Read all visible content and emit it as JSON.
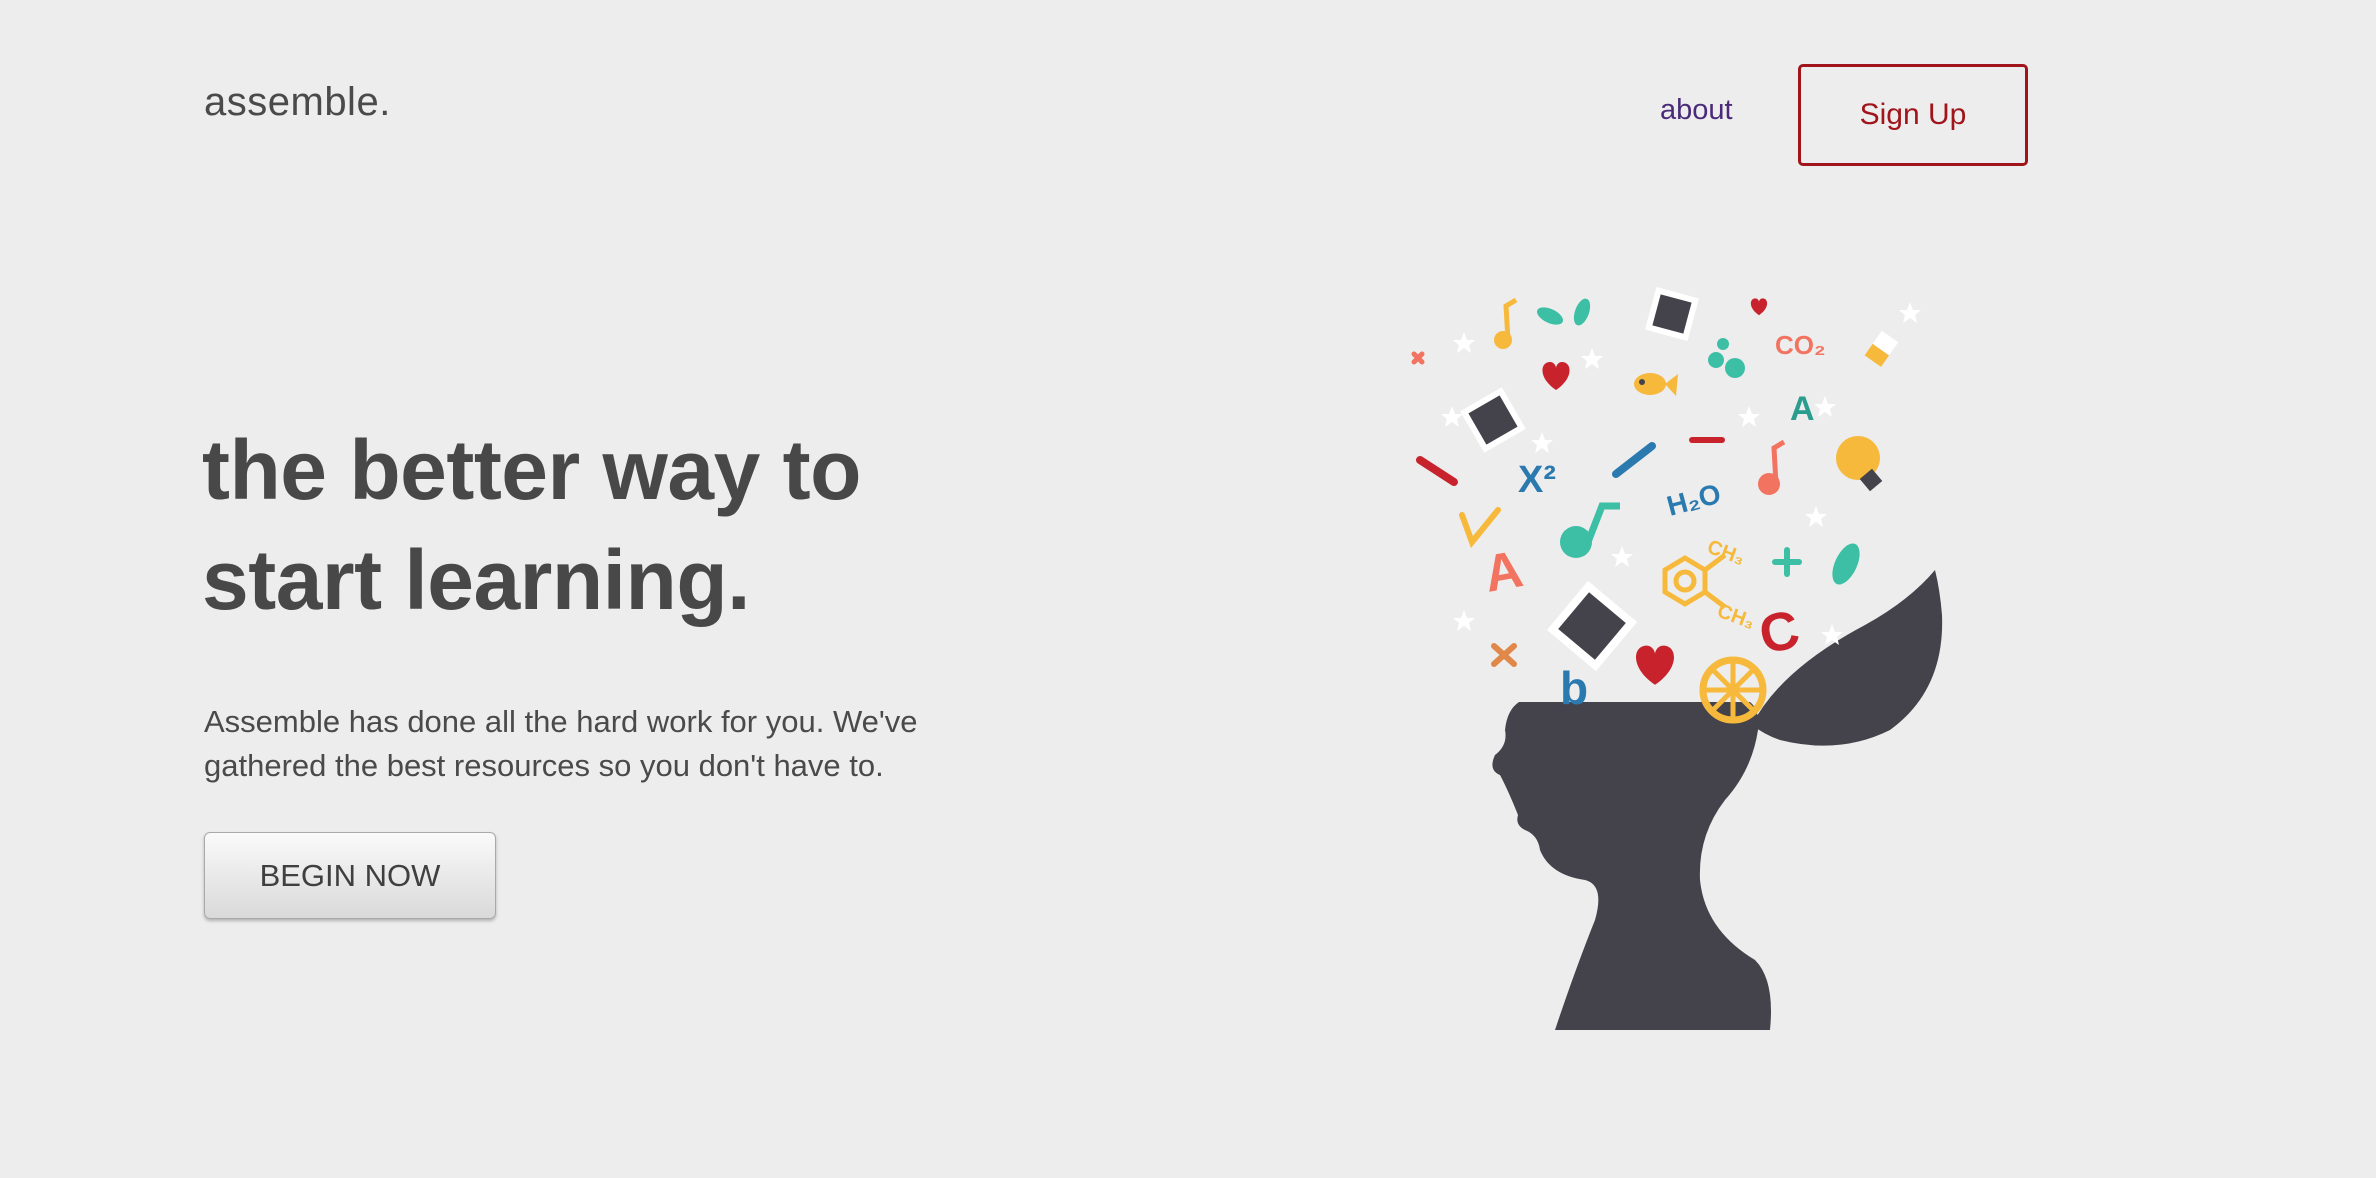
{
  "header": {
    "logo": "assemble.",
    "nav_about": "about",
    "signup_label": "Sign Up"
  },
  "hero": {
    "title_line1": "the better way to",
    "title_line2": "start learning.",
    "description_line1": "Assemble has done all the hard work for you. We've",
    "description_line2": "gathered the best resources so you don't have to.",
    "cta_label": "BEGIN NOW"
  },
  "illustration": {
    "icons": [
      "head-silhouette-icon",
      "music-note-icon",
      "leaf-icon",
      "heart-icon",
      "photo-frame-icon",
      "fish-icon",
      "bubbles-icon",
      "lightbulb-icon",
      "pencil-icon",
      "plus-icon",
      "star-icon",
      "wheel-icon",
      "benzene-icon"
    ],
    "formula_co2": "CO₂",
    "formula_h2o": "H₂O",
    "formula_x2": "X²",
    "formula_ch3_a": "CH₃",
    "formula_ch3_b": "CH₃",
    "letter_a1": "A",
    "letter_a2": "A",
    "letter_c": "C",
    "letter_b": "b"
  },
  "colors": {
    "background": "#ededed",
    "text": "#484848",
    "accent_red": "#a0141b",
    "link_purple": "#4b2a7a",
    "silhouette": "#44434b",
    "coral": "#f2735f",
    "teal": "#3dbfa5",
    "yellow": "#f6b93b",
    "blue": "#2a7ab0",
    "crimson": "#c8232c"
  }
}
